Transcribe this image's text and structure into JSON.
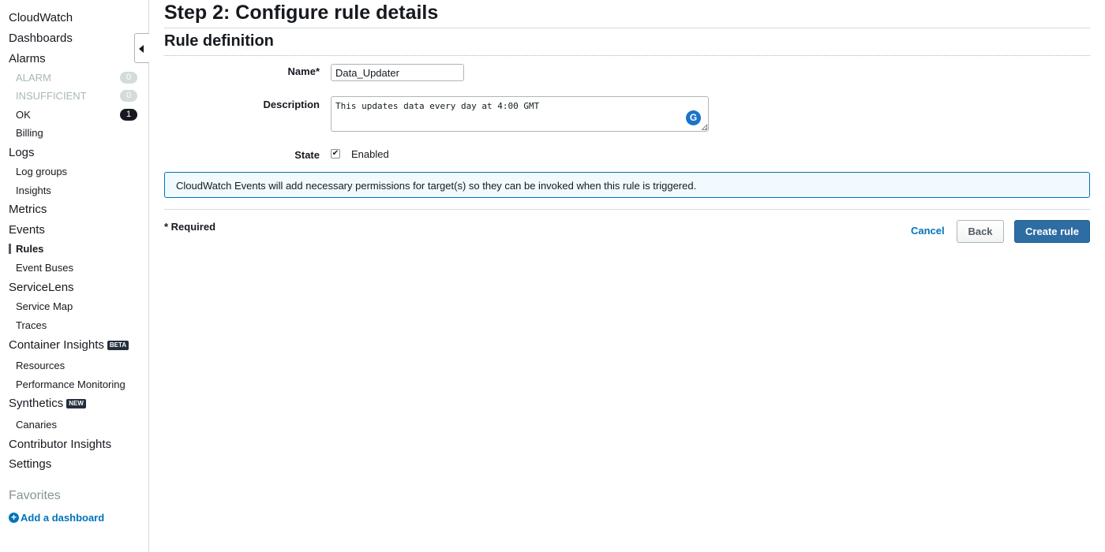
{
  "sidebar": {
    "cloudwatch": "CloudWatch",
    "dashboards": "Dashboards",
    "alarms": "Alarms",
    "alarm_state": "ALARM",
    "alarm_count": "0",
    "insufficient": "INSUFFICIENT",
    "insufficient_count": "0",
    "ok": "OK",
    "ok_count": "1",
    "billing": "Billing",
    "logs": "Logs",
    "log_groups": "Log groups",
    "insights": "Insights",
    "metrics": "Metrics",
    "events": "Events",
    "rules": "Rules",
    "event_buses": "Event Buses",
    "servicelens": "ServiceLens",
    "service_map": "Service Map",
    "traces": "Traces",
    "container_insights": "Container Insights",
    "beta_tag": "BETA",
    "resources": "Resources",
    "performance_monitoring": "Performance Monitoring",
    "synthetics": "Synthetics",
    "new_tag": "NEW",
    "canaries": "Canaries",
    "contributor_insights": "Contributor Insights",
    "settings": "Settings",
    "favorites": "Favorites",
    "add_dashboard": "Add a dashboard"
  },
  "main": {
    "page_title": "Step 2: Configure rule details",
    "section_title": "Rule definition",
    "form": {
      "name_label": "Name*",
      "name_value": "Data_Updater",
      "description_label": "Description",
      "description_value": "This updates data every day at 4:00 GMT",
      "state_label": "State",
      "state_value": "Enabled",
      "state_checked": true
    },
    "info_message": "CloudWatch Events will add necessary permissions for target(s) so they can be invoked when this rule is triggered.",
    "required_note": "* Required",
    "buttons": {
      "cancel": "Cancel",
      "back": "Back",
      "create": "Create rule"
    }
  },
  "colors": {
    "link": "#0073bb",
    "primary_button": "#2e6da4",
    "info_border": "#0073bb"
  }
}
